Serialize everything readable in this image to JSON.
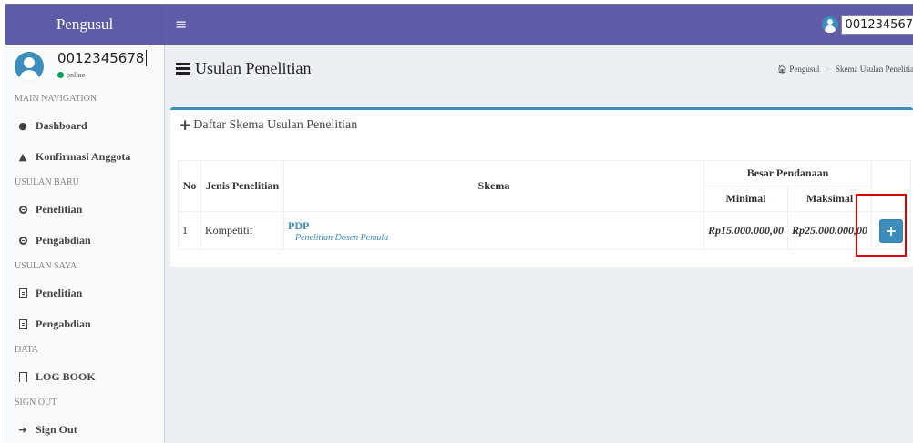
{
  "app": {
    "title": "Pengusul"
  },
  "topbar": {
    "menu_icon": "hamburger-icon",
    "user_id": "001234567"
  },
  "user_panel": {
    "username": "0012345678",
    "status": "online"
  },
  "sidebar": {
    "sections": [
      {
        "header": "MAIN NAVIGATION",
        "items": [
          {
            "label": "Dashboard",
            "icon": "dashboard-icon"
          },
          {
            "label": "Konfirmasi Anggota",
            "icon": "warning-icon"
          }
        ]
      },
      {
        "header": "USULAN BARU",
        "items": [
          {
            "label": "Penelitian",
            "icon": "circle-icon"
          },
          {
            "label": "Pengabdian",
            "icon": "circle-icon"
          }
        ]
      },
      {
        "header": "USULAN SAYA",
        "items": [
          {
            "label": "Penelitian",
            "icon": "document-icon"
          },
          {
            "label": "Pengabdian",
            "icon": "document-icon"
          }
        ]
      },
      {
        "header": "DATA",
        "items": [
          {
            "label": "LOG BOOK",
            "icon": "bookmark-icon"
          }
        ]
      },
      {
        "header": "SIGN OUT",
        "items": [
          {
            "label": "Sign Out",
            "icon": "sign-out-icon"
          }
        ]
      }
    ]
  },
  "page": {
    "title": "Usulan Penelitian",
    "breadcrumb": [
      "Pengusul",
      "Skema Usulan Penelitia"
    ]
  },
  "box": {
    "title": "Daftar Skema Usulan Penelitian",
    "table": {
      "headers": {
        "no": "No",
        "jenis": "Jenis Penelitian",
        "skema": "Skema",
        "pendanaan": "Besar Pendanaan",
        "minimal": "Minimal",
        "maksimal": "Maksimal"
      },
      "rows": [
        {
          "no": "1",
          "jenis": "Kompetitif",
          "skema_code": "PDP",
          "skema_name": "Penelitian Dosen Pemula",
          "minimal": "Rp15.000.000,00",
          "maksimal": "Rp25.000.000,00",
          "action": "+"
        }
      ]
    }
  },
  "colors": {
    "navbar": "#605ca8",
    "primary": "#3c8dbc",
    "highlight": "#e00000"
  }
}
